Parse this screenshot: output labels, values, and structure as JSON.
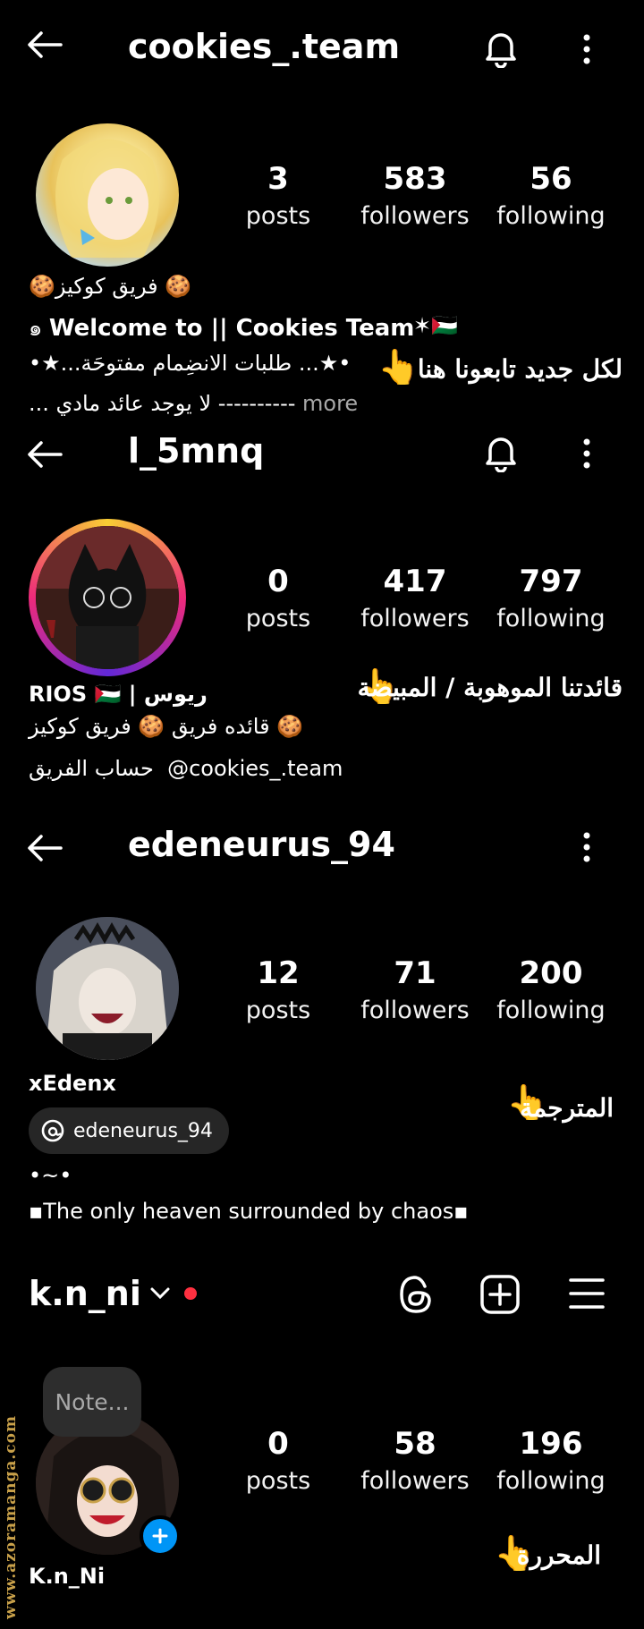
{
  "profile1": {
    "username": "cookies_.team",
    "stats": [
      {
        "value": "3",
        "label": "posts"
      },
      {
        "value": "583",
        "label": "followers"
      },
      {
        "value": "56",
        "label": "following"
      }
    ],
    "bio_line1": "🍪 فريق كوكيز🍪",
    "bio_line2_prefix": "๑ ",
    "bio_line2": "Welcome to || Cookies Team",
    "bio_line2_flag": "✶🇵🇸",
    "bio_line3": "•★... طلبات الانضِمام مفتوحَة...★•",
    "bio_line4": "---------- لا يوجد عائد مادي ...",
    "more_label": "more",
    "note": "لكل جديد تابعونا هنا",
    "hand": "👆"
  },
  "profile2": {
    "username": "l_5mnq",
    "stats": [
      {
        "value": "0",
        "label": "posts"
      },
      {
        "value": "417",
        "label": "followers"
      },
      {
        "value": "797",
        "label": "following"
      }
    ],
    "name": "ريوس | RIOS 🇵🇸",
    "bio_line1": "🍪 قائده فريق 🍪 فريق كوكيز",
    "bio_line2_arabic": "حساب الفريق",
    "bio_line2_handle": "@cookies_.team",
    "note": "قائدتنا الموهوبة / المبيضة",
    "hand": "👆"
  },
  "profile3": {
    "username": "edeneurus_94",
    "stats": [
      {
        "value": "12",
        "label": "posts"
      },
      {
        "value": "71",
        "label": "followers"
      },
      {
        "value": "200",
        "label": "following"
      }
    ],
    "name": "xEdenx",
    "threads_handle": "edeneurus_94",
    "bio_line1": "•~•",
    "bio_line2": "▪The only heaven surrounded by chaos▪",
    "note": "المترجمة",
    "hand": "👆"
  },
  "profile4": {
    "username": "k.n_ni",
    "note_bubble": "Note...",
    "stats": [
      {
        "value": "0",
        "label": "posts"
      },
      {
        "value": "58",
        "label": "followers"
      },
      {
        "value": "196",
        "label": "following"
      }
    ],
    "name": "K.n_Ni",
    "note": "المحررة",
    "hand": "👆"
  },
  "watermark": "www.azoramanga.com",
  "colors": {
    "background": "#000000",
    "story_ring_start": "#f9ce34",
    "story_ring_mid": "#ee2a7b",
    "story_ring_end": "#6228d7",
    "add_badge": "#0095f6",
    "online_dot": "#ff3040"
  }
}
